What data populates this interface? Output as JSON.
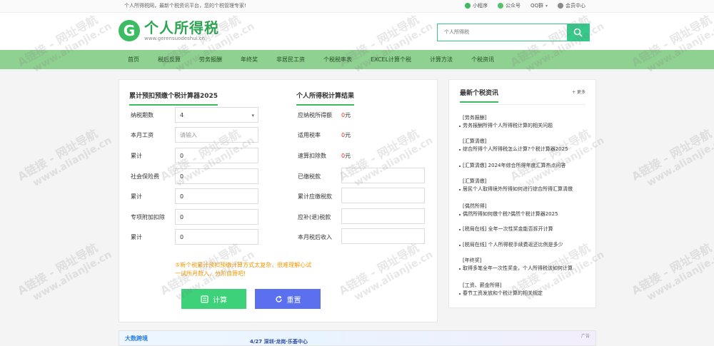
{
  "topbar": {
    "slogan": "个人所得税网，最新个税资讯平台，您的个税管理专家!",
    "links": [
      {
        "label": "小程序",
        "icon": "miniprogram-icon"
      },
      {
        "label": "公众号",
        "icon": "wechat-icon"
      },
      {
        "label": "QQ群",
        "icon": "chevron-down-icon"
      },
      {
        "label": "会员中心",
        "icon": "user-icon"
      }
    ]
  },
  "header": {
    "logo_mark": "G",
    "site_title": "个人所得税",
    "site_domain": "www.gerensuodeshui.cn",
    "search_placeholder": "个人所得税"
  },
  "nav": [
    "首页",
    "税后反算",
    "劳务报酬",
    "年终奖",
    "非居民工资",
    "个税税率表",
    "EXCEL计算个税",
    "计算方法",
    "个税资讯"
  ],
  "calculator": {
    "title": "累计预扣预缴个税计算器2025",
    "fields": [
      {
        "label": "纳税期数",
        "value": "4",
        "type": "select"
      },
      {
        "label": "本月工资",
        "value": "",
        "placeholder": "请输入"
      },
      {
        "label": "累计",
        "value": "0"
      },
      {
        "label": "社会保险费",
        "value": "0"
      },
      {
        "label": "累计",
        "value": "0"
      },
      {
        "label": "专项附加扣除",
        "value": "0"
      },
      {
        "label": "累计",
        "value": "0"
      }
    ],
    "note": "⑤新个税累计预扣预缴计算方式太复杂，很难理解心试一试所月数入，分阶自算吧!",
    "calc_button": "计算",
    "reset_button": "重置"
  },
  "results": {
    "title": "个人所得税计算结果",
    "rows": [
      {
        "label": "应纳税所得额",
        "value": "0",
        "unit": "元"
      },
      {
        "label": "适用税率",
        "value": "0",
        "unit": "元"
      },
      {
        "label": "速算扣除数",
        "value": "0",
        "unit": "元"
      },
      {
        "label": "已缴税款",
        "value": ""
      },
      {
        "label": "累计应缴税款",
        "value": ""
      },
      {
        "label": "应补(退)税款",
        "value": ""
      },
      {
        "label": "本月税后收入",
        "value": ""
      }
    ]
  },
  "news": {
    "title": "最新个税资讯",
    "more": "+ 更多",
    "items": [
      {
        "line1": "[劳务报酬]",
        "line2": "劳务报酬所得个人所得税计算的相关问题"
      },
      {
        "line1": "[汇算清缴]",
        "line2": "综合所得个人所得税怎么计算?个税计算器2025"
      },
      {
        "line1": "[汇算清缴] 2024年综合所得年度汇算热点问答",
        "line2": ""
      },
      {
        "line1": "[汇算清缴]",
        "line2": "居民个人取得境外所得如何进行综合所得汇算清缴"
      },
      {
        "line1": "[偶然所得]",
        "line2": "偶然所得如何缴个税?偶然个税计算器2025"
      },
      {
        "line1": "[税局在线] 全年一次性奖金能否拆开计算",
        "line2": ""
      },
      {
        "line1": "[税局在线] 个人所得税手续费返还比例是多少",
        "line2": ""
      },
      {
        "line1": "[年终奖]",
        "line2": "取得多笔全年一次性奖金，个人所得税该如何计算"
      },
      {
        "line1": "[工资、薪金所得]",
        "line2": "春节工资发放和个税计算的相关规定"
      }
    ]
  },
  "ad": {
    "brand": "大数跨境",
    "text": "4/27 深圳·龙岗·乐荟中心",
    "tag": "广告"
  },
  "watermark": {
    "line1": "A链接 - 网址导航",
    "line2": "www.alianjie.cn"
  },
  "colors": {
    "brand_green": "#3dbb63",
    "nav_green": "#8fd191",
    "calc_button": "#3dd17a",
    "reset_button": "#5b70ef",
    "result_red": "#e02e24",
    "note_orange": "#f39800"
  }
}
